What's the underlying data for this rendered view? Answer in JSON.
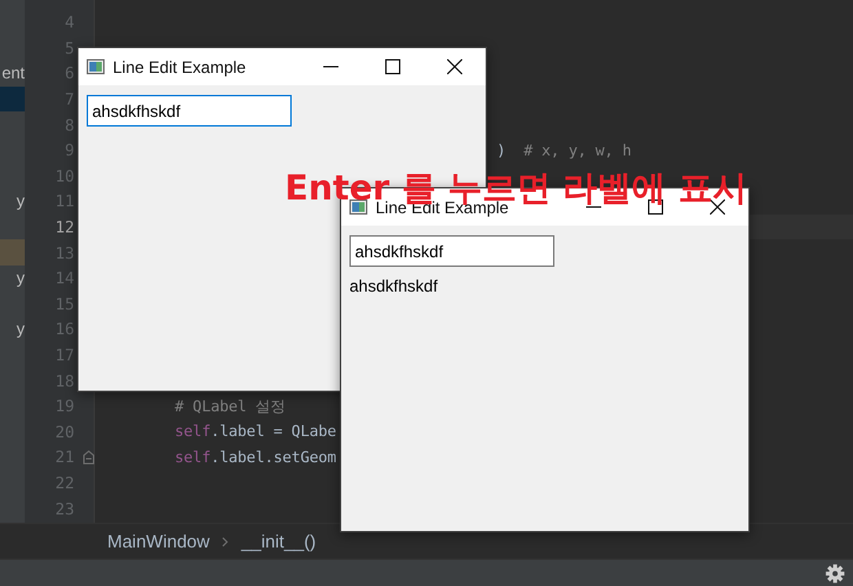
{
  "ide": {
    "lines": [
      {
        "number": "4"
      },
      {
        "number": "5"
      },
      {
        "number": "6",
        "tree": {
          "label": "ent"
        }
      },
      {
        "number": "7",
        "tree": {
          "color": "#0d293e"
        }
      },
      {
        "number": "8"
      },
      {
        "number": "9",
        "clipped": true,
        "code": [
          {
            "text": ")",
            "kind": "plain"
          },
          {
            "text": "  # x, y, w, h",
            "kind": "comment"
          }
        ]
      },
      {
        "number": "10"
      },
      {
        "number": "11",
        "tree": {
          "label": "y"
        }
      },
      {
        "number": "12",
        "current": true
      },
      {
        "number": "13",
        "tree": {
          "color": "#5a5140"
        }
      },
      {
        "number": "14",
        "tree": {
          "label": "y"
        }
      },
      {
        "number": "15"
      },
      {
        "number": "16",
        "tree": {
          "label": "y"
        }
      },
      {
        "number": "17"
      },
      {
        "number": "18"
      },
      {
        "number": "19",
        "code": [
          {
            "text": "# QLabel 설정",
            "kind": "comment"
          }
        ]
      },
      {
        "number": "20",
        "code": [
          {
            "text": "self",
            "kind": "keyword"
          },
          {
            "text": ".label = QLabe",
            "kind": "plain"
          }
        ]
      },
      {
        "number": "21",
        "fold": true,
        "code": [
          {
            "text": "self",
            "kind": "keyword"
          },
          {
            "text": ".label.setGeom",
            "kind": "plain"
          }
        ]
      },
      {
        "number": "22"
      },
      {
        "number": "23"
      }
    ],
    "breadcrumb": [
      "MainWindow",
      "__init__()"
    ]
  },
  "windows": [
    {
      "title": "Line Edit Example",
      "input": {
        "value": "ahsdkfhskdf",
        "focused": true
      }
    },
    {
      "title": "Line Edit Example",
      "input": {
        "value": "ahsdkfhskdf",
        "focused": false
      },
      "label": "ahsdkfhskdf"
    }
  ],
  "overlay_caption": "Enter 를 누르면 라벨에 표시"
}
